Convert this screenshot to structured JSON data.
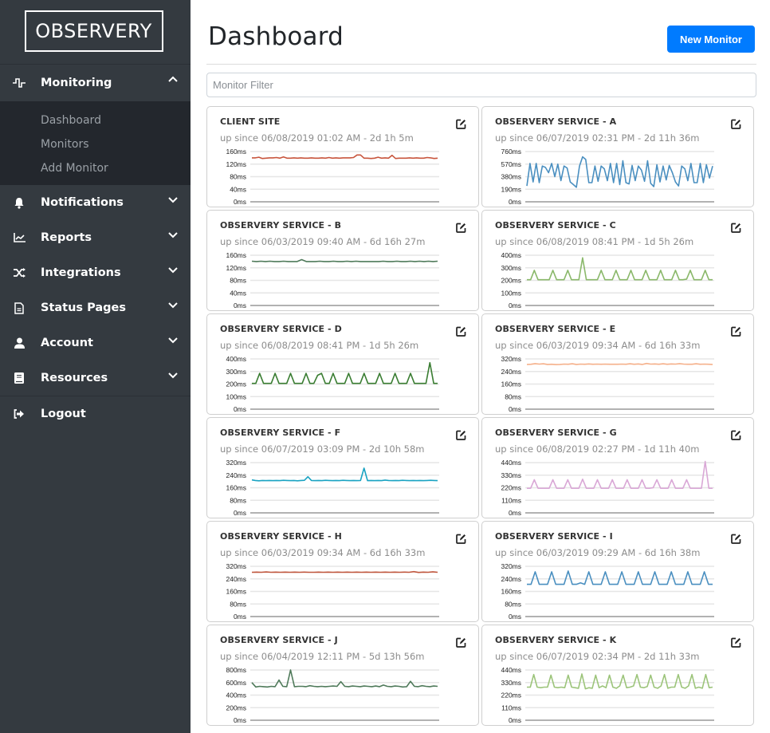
{
  "sidebar": {
    "logo": "OBSERVERY",
    "monitoring": {
      "label": "Monitoring",
      "icon": "pulse-icon",
      "expanded": true,
      "items": [
        {
          "label": "Dashboard"
        },
        {
          "label": "Monitors"
        },
        {
          "label": "Add Monitor"
        }
      ]
    },
    "items": [
      {
        "label": "Notifications",
        "icon": "bell-icon"
      },
      {
        "label": "Reports",
        "icon": "chart-line-icon"
      },
      {
        "label": "Integrations",
        "icon": "shuffle-icon"
      },
      {
        "label": "Status Pages",
        "icon": "file-icon"
      },
      {
        "label": "Account",
        "icon": "user-icon"
      },
      {
        "label": "Resources",
        "icon": "book-icon"
      }
    ],
    "logout": {
      "label": "Logout",
      "icon": "sign-out-icon"
    }
  },
  "header": {
    "title": "Dashboard",
    "new_monitor_label": "New Monitor",
    "filter_placeholder": "Monitor Filter",
    "filter_value": ""
  },
  "colors": {
    "accent": "#007bff",
    "sidebar_bg": "#343a40",
    "submenu_bg": "#23272d"
  },
  "chart_data": [
    {
      "type": "line",
      "title": "CLIENT SITE",
      "subtitle": "up since 06/08/2019 01:02 AM - 2d 1h 5m",
      "color": "#c8553d",
      "yticks": [
        "0ms",
        "40ms",
        "80ms",
        "120ms",
        "160ms"
      ],
      "ylim": [
        0,
        160
      ],
      "values": [
        140,
        140,
        142,
        138,
        139,
        140,
        140,
        141,
        139,
        143,
        139,
        139,
        140,
        139,
        140,
        139,
        139,
        140,
        139,
        139,
        140,
        139,
        141,
        139,
        140,
        139,
        140,
        140,
        140,
        141,
        149,
        149,
        139,
        139,
        138,
        139,
        142,
        139,
        140,
        139,
        148,
        138,
        139,
        139,
        139,
        140,
        139,
        140,
        139,
        139,
        141,
        140,
        138,
        139
      ]
    },
    {
      "type": "line",
      "title": "OBSERVERY SERVICE - A",
      "subtitle": "up since 06/07/2019 02:31 PM - 2d 11h 36m",
      "color": "#4a8fc0",
      "yticks": [
        "0ms",
        "190ms",
        "380ms",
        "570ms",
        "760ms"
      ],
      "ylim": [
        0,
        760
      ],
      "values": [
        240,
        580,
        300,
        580,
        290,
        540,
        520,
        440,
        580,
        380,
        570,
        320,
        540,
        510,
        300,
        260,
        220,
        540,
        680,
        640,
        290,
        290,
        540,
        310,
        540,
        500,
        320,
        580,
        290,
        580,
        260,
        620,
        290,
        270,
        550,
        320,
        540,
        480,
        310,
        620,
        280,
        230,
        560,
        300,
        540,
        330,
        550,
        440,
        300,
        240,
        540,
        500,
        320,
        580,
        290,
        290,
        580,
        290,
        560,
        360,
        540
      ]
    },
    {
      "type": "line",
      "title": "OBSERVERY SERVICE - B",
      "subtitle": "up since 06/03/2019 09:40 AM - 6d 16h 27m",
      "color": "#4f7a5a",
      "yticks": [
        "0ms",
        "40ms",
        "80ms",
        "120ms",
        "160ms"
      ],
      "ylim": [
        0,
        160
      ],
      "values": [
        141,
        140,
        141,
        140,
        141,
        140,
        140,
        141,
        140,
        140,
        140,
        146,
        140,
        140,
        140,
        141,
        140,
        140,
        141,
        140,
        140,
        141,
        140,
        141,
        140,
        140,
        140,
        140,
        140,
        141,
        140,
        140,
        141,
        140,
        140,
        141,
        140,
        141,
        140,
        141,
        140,
        141
      ]
    },
    {
      "type": "line",
      "title": "OBSERVERY SERVICE - C",
      "subtitle": "up since 06/08/2019 08:41 PM - 1d 5h 26m",
      "color": "#8ab86a",
      "yticks": [
        "0ms",
        "100ms",
        "200ms",
        "300ms",
        "400ms"
      ],
      "ylim": [
        0,
        400
      ],
      "values": [
        205,
        205,
        280,
        205,
        205,
        205,
        205,
        280,
        205,
        205,
        205,
        280,
        205,
        205,
        205,
        380,
        205,
        205,
        205,
        205,
        280,
        205,
        205,
        205,
        280,
        205,
        205,
        205,
        280,
        205,
        205,
        205,
        280,
        205,
        205,
        205,
        280,
        205,
        205,
        205,
        280,
        205,
        205,
        210,
        280,
        205,
        205,
        205,
        280,
        205,
        205
      ]
    },
    {
      "type": "line",
      "title": "OBSERVERY SERVICE - D",
      "subtitle": "up since 06/08/2019 08:41 PM - 1d 5h 26m",
      "color": "#3a7d32",
      "yticks": [
        "0ms",
        "100ms",
        "200ms",
        "300ms",
        "400ms"
      ],
      "ylim": [
        0,
        400
      ],
      "values": [
        205,
        205,
        285,
        205,
        205,
        205,
        285,
        205,
        205,
        205,
        285,
        205,
        205,
        205,
        285,
        205,
        205,
        270,
        285,
        205,
        205,
        285,
        205,
        205,
        205,
        285,
        205,
        205,
        205,
        285,
        205,
        205,
        205,
        285,
        205,
        205,
        205,
        285,
        205,
        205,
        205,
        285,
        205,
        205,
        205,
        205,
        370,
        205,
        205
      ]
    },
    {
      "type": "line",
      "title": "OBSERVERY SERVICE - E",
      "subtitle": "up since 06/03/2019 09:34 AM - 6d 16h 33m",
      "color": "#f5b08a",
      "yticks": [
        "0ms",
        "80ms",
        "160ms",
        "240ms",
        "320ms"
      ],
      "ylim": [
        0,
        320
      ],
      "values": [
        285,
        286,
        290,
        287,
        289,
        285,
        286,
        284,
        285,
        287,
        286,
        289,
        285,
        287,
        286,
        288,
        286,
        287,
        286,
        287,
        286,
        286,
        286,
        287,
        286,
        289,
        286,
        288,
        285,
        291,
        287,
        288,
        286,
        289,
        286,
        288,
        287,
        290,
        287,
        286,
        286,
        289,
        286,
        287,
        286,
        285
      ]
    },
    {
      "type": "line",
      "title": "OBSERVERY SERVICE - F",
      "subtitle": "up since 06/07/2019 03:09 PM - 2d 10h 58m",
      "color": "#1aa3c2",
      "yticks": [
        "0ms",
        "80ms",
        "160ms",
        "240ms",
        "320ms"
      ],
      "ylim": [
        0,
        320
      ],
      "values": [
        210,
        206,
        204,
        206,
        205,
        206,
        205,
        206,
        205,
        207,
        206,
        205,
        206,
        204,
        206,
        207,
        230,
        206,
        205,
        206,
        205,
        207,
        206,
        205,
        206,
        205,
        207,
        206,
        205,
        206,
        205,
        206,
        285,
        205,
        206,
        205,
        206,
        205,
        209,
        206,
        205,
        206,
        205,
        207,
        206,
        205,
        206,
        205,
        206,
        205,
        206,
        207,
        206,
        205
      ]
    },
    {
      "type": "line",
      "title": "OBSERVERY SERVICE - G",
      "subtitle": "up since 06/08/2019 02:27 PM - 1d 11h 40m",
      "color": "#d9a8d6",
      "yticks": [
        "0ms",
        "110ms",
        "220ms",
        "330ms",
        "440ms"
      ],
      "ylim": [
        0,
        440
      ],
      "values": [
        215,
        215,
        290,
        215,
        215,
        215,
        215,
        290,
        215,
        215,
        215,
        290,
        215,
        215,
        215,
        295,
        215,
        215,
        215,
        290,
        215,
        215,
        215,
        290,
        215,
        215,
        215,
        290,
        215,
        215,
        215,
        290,
        215,
        215,
        220,
        290,
        215,
        215,
        215,
        290,
        215,
        215,
        215,
        290,
        215,
        215,
        215,
        215,
        450,
        215,
        215
      ]
    },
    {
      "type": "line",
      "title": "OBSERVERY SERVICE - H",
      "subtitle": "up since 06/03/2019 09:34 AM - 6d 16h 33m",
      "color": "#c0573e",
      "yticks": [
        "0ms",
        "80ms",
        "160ms",
        "240ms",
        "320ms"
      ],
      "ylim": [
        0,
        320
      ],
      "values": [
        282,
        283,
        282,
        284,
        282,
        283,
        282,
        283,
        282,
        283,
        282,
        283,
        282,
        282,
        283,
        282,
        283,
        282,
        283,
        282,
        283,
        282,
        283,
        282,
        283,
        282,
        283,
        282,
        283,
        282,
        283,
        282,
        283,
        282,
        286,
        281,
        283,
        282,
        285,
        282
      ]
    },
    {
      "type": "line",
      "title": "OBSERVERY SERVICE - I",
      "subtitle": "up since 06/03/2019 09:29 AM - 6d 16h 38m",
      "color": "#4a8fc0",
      "yticks": [
        "0ms",
        "80ms",
        "160ms",
        "240ms",
        "320ms"
      ],
      "ylim": [
        0,
        320
      ],
      "values": [
        205,
        205,
        285,
        205,
        205,
        205,
        285,
        205,
        205,
        205,
        290,
        205,
        205,
        215,
        205,
        285,
        205,
        205,
        205,
        285,
        205,
        205,
        205,
        285,
        205,
        205,
        205,
        285,
        205,
        205,
        205,
        285,
        205,
        205,
        205,
        285,
        205,
        205,
        205,
        285,
        205,
        205,
        205,
        285,
        205,
        205
      ]
    },
    {
      "type": "line",
      "title": "OBSERVERY SERVICE - J",
      "subtitle": "up since 06/04/2019 12:11 PM - 5d 13h 56m",
      "color": "#4f7a5a",
      "yticks": [
        "0ms",
        "200ms",
        "400ms",
        "600ms",
        "800ms"
      ],
      "ylim": [
        0,
        800
      ],
      "values": [
        600,
        530,
        540,
        535,
        530,
        540,
        535,
        640,
        540,
        535,
        800,
        535,
        540,
        540,
        535,
        550,
        540,
        535,
        540,
        535,
        540,
        545,
        540,
        615,
        540,
        535,
        545,
        540,
        535,
        545,
        540,
        535,
        545,
        535,
        560,
        540,
        535,
        545,
        540,
        530,
        535,
        620,
        540,
        535,
        550,
        540,
        535,
        545,
        540
      ]
    },
    {
      "type": "line",
      "title": "OBSERVERY SERVICE - K",
      "subtitle": "up since 06/07/2019 02:34 PM - 2d 11h 33m",
      "color": "#9cc47a",
      "yticks": [
        "0ms",
        "110ms",
        "220ms",
        "330ms",
        "440ms"
      ],
      "ylim": [
        0,
        440
      ],
      "values": [
        290,
        290,
        400,
        290,
        285,
        290,
        290,
        395,
        290,
        285,
        290,
        285,
        395,
        290,
        285,
        280,
        405,
        275,
        285,
        280,
        395,
        285,
        300,
        285,
        395,
        290,
        280,
        300,
        395,
        285,
        290,
        300,
        400,
        290,
        285,
        295,
        395,
        290,
        280,
        300,
        400,
        280,
        290,
        290,
        400,
        290,
        280,
        300,
        400,
        280,
        290,
        280,
        400,
        285,
        290
      ]
    }
  ]
}
